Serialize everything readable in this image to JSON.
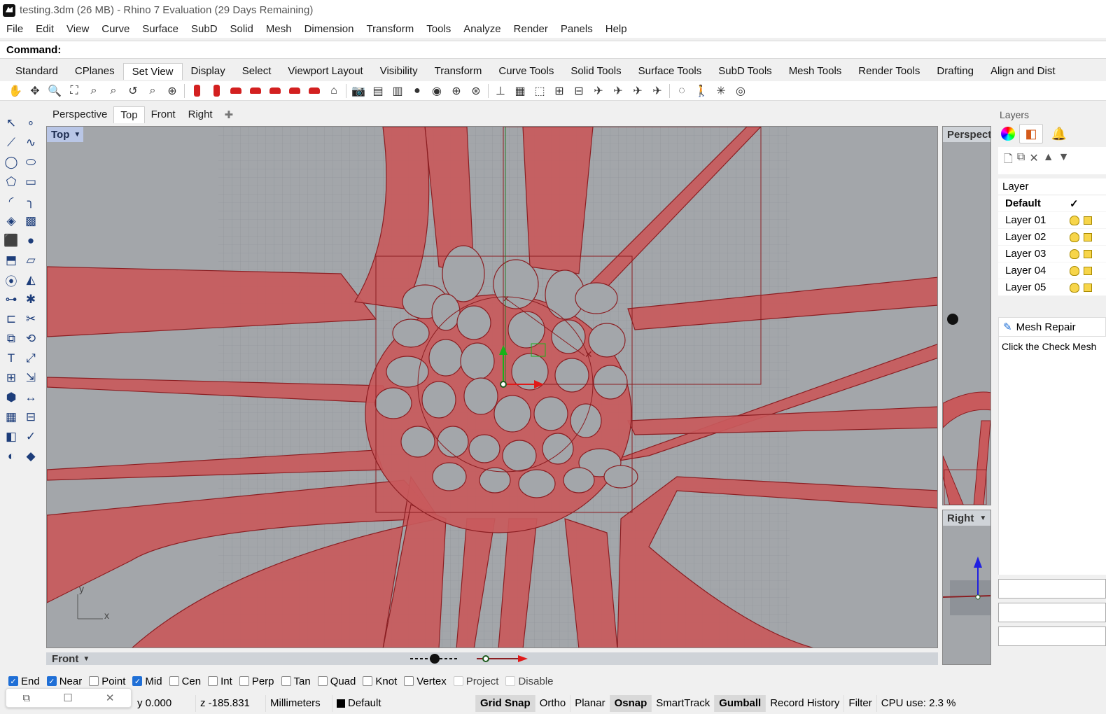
{
  "window": {
    "title": "testing.3dm (26 MB) - Rhino 7 Evaluation (29 Days Remaining)"
  },
  "menu": [
    "File",
    "Edit",
    "View",
    "Curve",
    "Surface",
    "SubD",
    "Solid",
    "Mesh",
    "Dimension",
    "Transform",
    "Tools",
    "Analyze",
    "Render",
    "Panels",
    "Help"
  ],
  "command": {
    "label": "Command:",
    "value": ""
  },
  "toolbar_tabs": [
    "Standard",
    "CPlanes",
    "Set View",
    "Display",
    "Select",
    "Viewport Layout",
    "Visibility",
    "Transform",
    "Curve Tools",
    "Solid Tools",
    "Surface Tools",
    "SubD Tools",
    "Mesh Tools",
    "Render Tools",
    "Drafting",
    "Align and Dist"
  ],
  "active_toolbar_tab": "Set View",
  "toolbar_icons": [
    "pan-icon",
    "rotate-view-icon",
    "zoom-icon",
    "zoom-window-icon",
    "zoom-extents-icon",
    "zoom-selected-icon",
    "undo-view-icon",
    "zoom-dynamic-icon",
    "zoom-all-icon",
    "camera-can-icon",
    "camera-can-2-icon",
    "car-icon",
    "car-2-icon",
    "car-3-icon",
    "car-4-icon",
    "car-5-icon",
    "projector-icon",
    "camera-icon",
    "named-view-icon",
    "named-position-icon",
    "light-icon",
    "two-point-icon",
    "target-icon",
    "target-2-icon",
    "cplane-icon",
    "wireframe-icon",
    "box-view-icon",
    "place-camera-icon",
    "elevator-icon",
    "plane-icon",
    "plane-2-icon",
    "plane-3-icon",
    "plane-4-icon",
    "orbit-icon",
    "walk-icon",
    "spin-icon",
    "grid-icon"
  ],
  "viewport_tabs": [
    "Perspective",
    "Top",
    "Front",
    "Right"
  ],
  "active_viewport_tab": "Top",
  "viewports": {
    "main": {
      "name": "Top"
    },
    "perspective": {
      "name": "Perspect"
    },
    "right": {
      "name": "Right"
    },
    "front": {
      "name": "Front"
    }
  },
  "axis_labels": {
    "y": "y",
    "x": "x"
  },
  "colors": {
    "mesh_fill": "#c85a5c",
    "mesh_edge": "#8b1e22",
    "grid": "#8e9298",
    "viewport_bg": "#a3a6aa"
  },
  "panel": {
    "title": "Layers",
    "header": "Layer",
    "layers": [
      {
        "name": "Default",
        "current": true
      },
      {
        "name": "Layer 01"
      },
      {
        "name": "Layer 02"
      },
      {
        "name": "Layer 03"
      },
      {
        "name": "Layer 04"
      },
      {
        "name": "Layer 05"
      }
    ],
    "mesh_repair_title": "Mesh Repair",
    "mesh_repair_text": "Click the Check Mesh"
  },
  "osnaps": [
    {
      "label": "End",
      "checked": true
    },
    {
      "label": "Near",
      "checked": true
    },
    {
      "label": "Point",
      "checked": false
    },
    {
      "label": "Mid",
      "checked": true
    },
    {
      "label": "Cen",
      "checked": false
    },
    {
      "label": "Int",
      "checked": false
    },
    {
      "label": "Perp",
      "checked": false
    },
    {
      "label": "Tan",
      "checked": false
    },
    {
      "label": "Quad",
      "checked": false
    },
    {
      "label": "Knot",
      "checked": false
    },
    {
      "label": "Vertex",
      "checked": false
    },
    {
      "label": "Project",
      "checked": false,
      "disabled": true
    },
    {
      "label": "Disable",
      "checked": false,
      "disabled": true
    }
  ],
  "status": {
    "y": "y 0.000",
    "z": "z -185.831",
    "units": "Millimeters",
    "layer": "Default",
    "toggles": [
      {
        "label": "Grid Snap",
        "on": true
      },
      {
        "label": "Ortho",
        "on": false
      },
      {
        "label": "Planar",
        "on": false
      },
      {
        "label": "Osnap",
        "on": true
      },
      {
        "label": "SmartTrack",
        "on": false
      },
      {
        "label": "Gumball",
        "on": true
      },
      {
        "label": "Record History",
        "on": false
      },
      {
        "label": "Filter",
        "on": false
      }
    ],
    "cpu": "CPU use: 2.3 %"
  }
}
